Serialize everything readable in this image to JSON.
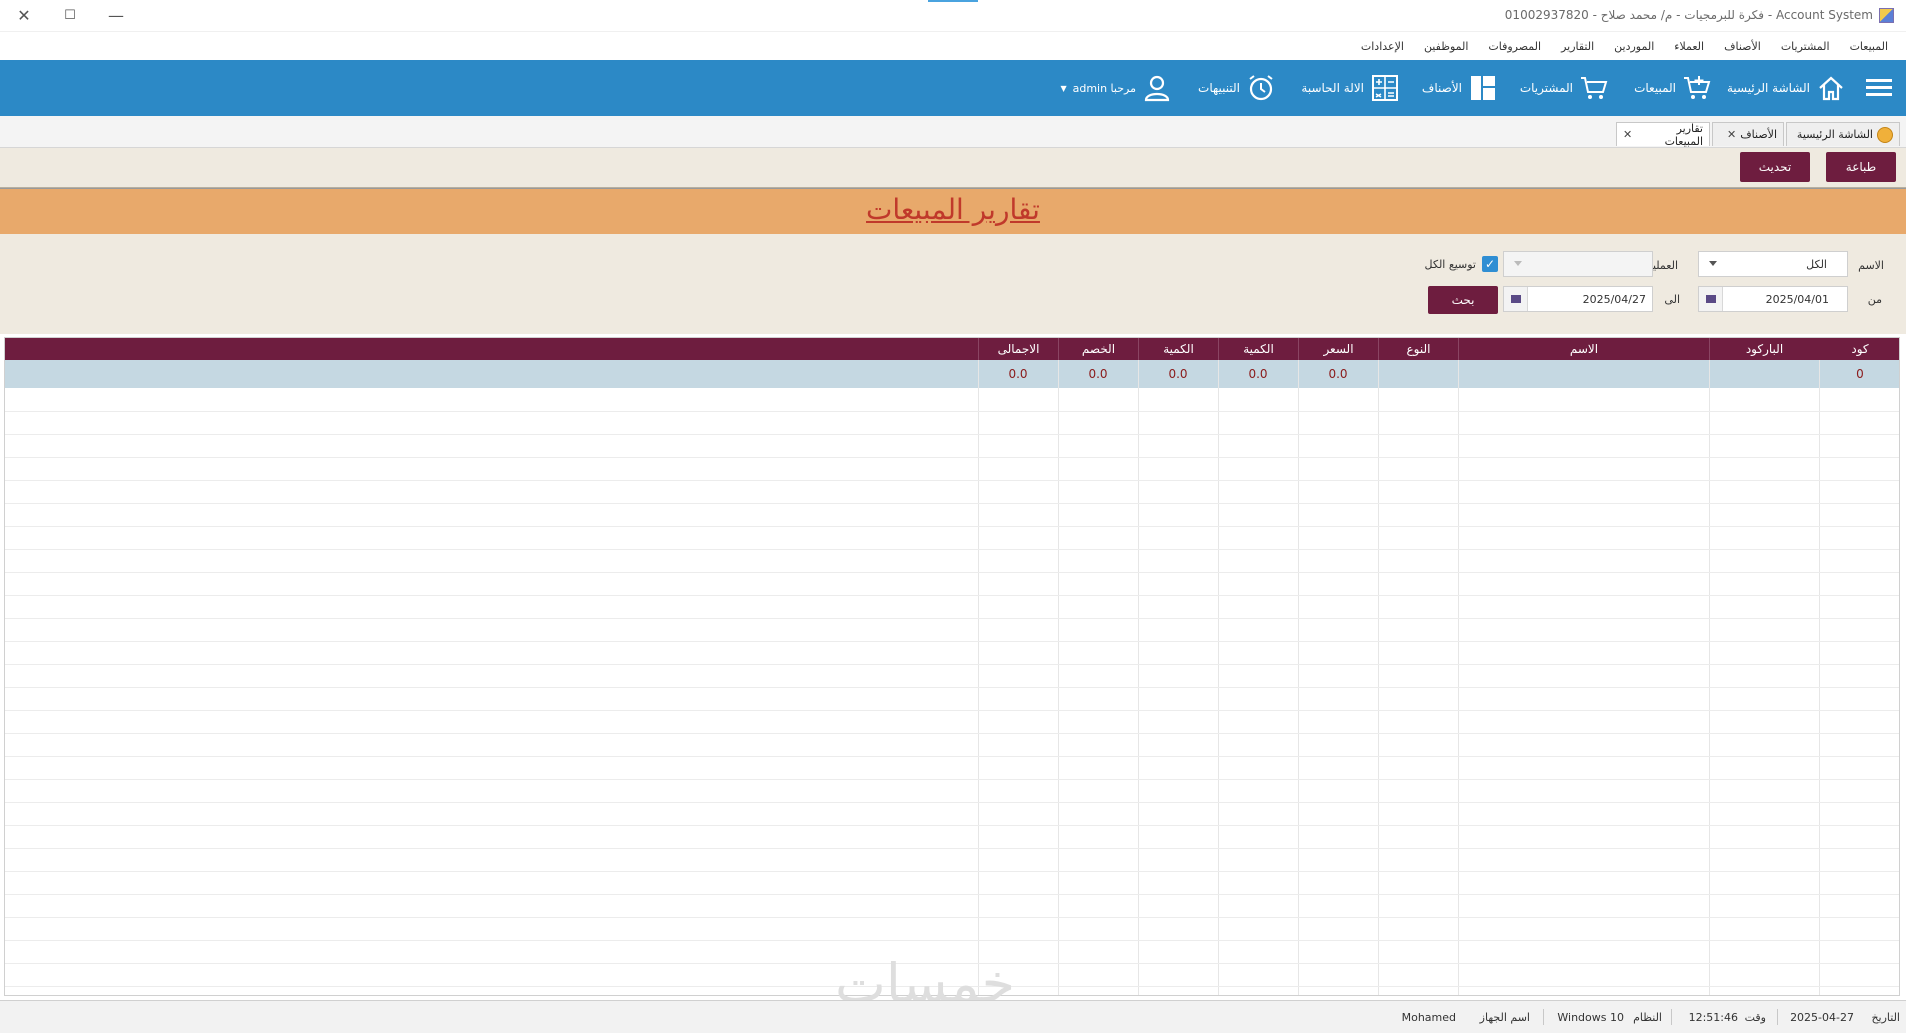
{
  "window": {
    "title": "Account System - فكرة للبرمجيات - م/ محمد صلاح - 01002937820"
  },
  "menu": [
    "المبيعات",
    "المشتريات",
    "الأصناف",
    "العملاء",
    "الموردين",
    "التقارير",
    "المصروفات",
    "الموظفين",
    "الإعدادات"
  ],
  "toolbar": {
    "home": "الشاشة الرئيسية",
    "sales": "المبيعات",
    "purchases": "المشتريات",
    "items": "الأصناف",
    "calculator": "الالة الحاسبة",
    "alerts": "التنبيهات",
    "user": "مرحبا admin"
  },
  "tabs": {
    "home": "الشاشة الرئيسية",
    "items": "الأصناف",
    "sales_reports": "تقارير المبيعات"
  },
  "actions": {
    "print": "طباعة",
    "refresh": "تحديث"
  },
  "page": {
    "title": "تقارير المبيعات"
  },
  "filters": {
    "name_label": "الاسم",
    "name_value": "الكل",
    "client_label": "العملية",
    "expand_label": "توسيع الكل",
    "from_label": "من",
    "from_date": "2025/04/01",
    "to_label": "الى",
    "to_date": "2025/04/27",
    "search": "بحث"
  },
  "grid": {
    "columns": [
      "كود",
      "الباركود",
      "الاسم",
      "النوع",
      "السعر",
      "الكمية",
      "الكمية",
      "الخصم",
      "الاجمالى"
    ],
    "rows": [
      [
        "0",
        "",
        "",
        "",
        "0.0",
        "0.0",
        "0.0",
        "0.0",
        "0.0"
      ]
    ]
  },
  "watermark": "خمسات",
  "status": {
    "date_label": "التاريخ",
    "date_value": "2025-04-27",
    "time_label": "وقت",
    "time_value": "12:51:46",
    "os_label": "النظام",
    "os_value": "Windows 10",
    "device_label": "اسم الجهاز",
    "device_value": "Mohamed"
  },
  "colors": {
    "toolbar": "#2c89c6",
    "maroon": "#6e1d3f",
    "banner": "#e8a96b",
    "title_red": "#c0392b",
    "panel": "#efeae0",
    "selected_row": "#c5d8e2"
  }
}
